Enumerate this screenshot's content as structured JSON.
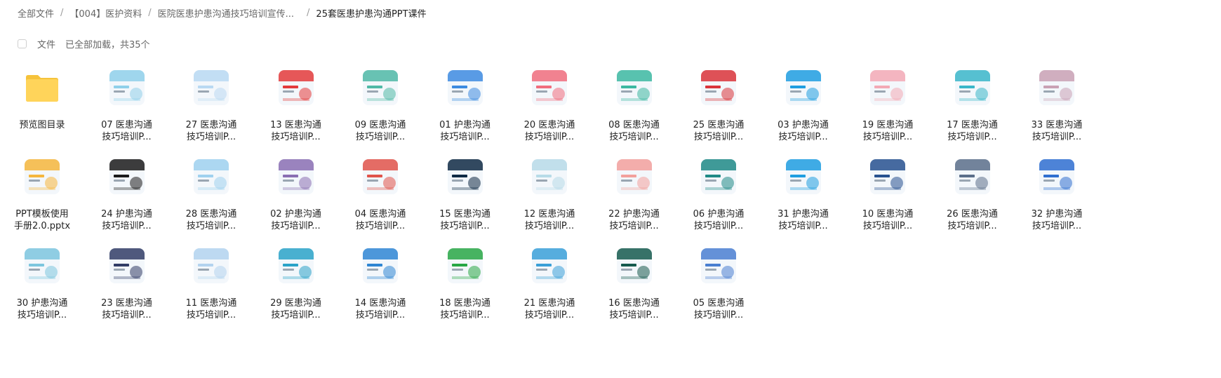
{
  "breadcrumb": {
    "items": [
      "全部文件",
      "【004】医护资料",
      "医院医患护患沟通技巧培训宣传...",
      "25套医患护患沟通PPT课件"
    ],
    "separator": "/"
  },
  "toolbar": {
    "label": "文件",
    "status": "已全部加载，共35个"
  },
  "files": [
    {
      "line1": "预览图目录",
      "line2": "",
      "icon": "folder-icon",
      "color": "#ffd45a"
    },
    {
      "line1": "07 医患沟通",
      "line2": "技巧培训P...",
      "icon": "ppt-thumb",
      "color": "#8fd0ea"
    },
    {
      "line1": "27 医患沟通",
      "line2": "技巧培训P...",
      "icon": "ppt-thumb",
      "color": "#b9d9f2"
    },
    {
      "line1": "13 医患沟通",
      "line2": "技巧培训P...",
      "icon": "ppt-thumb",
      "color": "#e33b3b"
    },
    {
      "line1": "09 医患沟通",
      "line2": "技巧培训P...",
      "icon": "ppt-thumb",
      "color": "#4fb9a6"
    },
    {
      "line1": "01 护患沟通",
      "line2": "技巧培训P...",
      "icon": "ppt-thumb",
      "color": "#3d8be0"
    },
    {
      "line1": "20 医患沟通",
      "line2": "技巧培训P...",
      "icon": "ppt-thumb",
      "color": "#f06d7d"
    },
    {
      "line1": "08 医患沟通",
      "line2": "技巧培训P...",
      "icon": "ppt-thumb",
      "color": "#3cb8a1"
    },
    {
      "line1": "25 医患沟通",
      "line2": "技巧培训P...",
      "icon": "ppt-thumb",
      "color": "#d9343a"
    },
    {
      "line1": "03 护患沟通",
      "line2": "技巧培训P...",
      "icon": "ppt-thumb",
      "color": "#1f9ee0"
    },
    {
      "line1": "19 医患沟通",
      "line2": "技巧培训P...",
      "icon": "ppt-thumb",
      "color": "#f3a9b5"
    },
    {
      "line1": "17 医患沟通",
      "line2": "技巧培训P...",
      "icon": "ppt-thumb",
      "color": "#39b6c9"
    },
    {
      "line1": "33 医患沟通",
      "line2": "技巧培训P...",
      "icon": "ppt-thumb",
      "color": "#c9a1b4"
    },
    {
      "line1": "PPT模板使用",
      "line2": "手册2.0.pptx",
      "icon": "ppt-thumb",
      "color": "#f5b63c"
    },
    {
      "line1": "24 护患沟通",
      "line2": "技巧培训P...",
      "icon": "ppt-thumb",
      "color": "#1b1b1b"
    },
    {
      "line1": "28 医患沟通",
      "line2": "技巧培训P...",
      "icon": "ppt-thumb",
      "color": "#9fd1ef"
    },
    {
      "line1": "02 护患沟通",
      "line2": "技巧培训P...",
      "icon": "ppt-thumb",
      "color": "#8a6fb3"
    },
    {
      "line1": "04 医患沟通",
      "line2": "技巧培训P...",
      "icon": "ppt-thumb",
      "color": "#e0534a"
    },
    {
      "line1": "15 医患沟通",
      "line2": "技巧培训P...",
      "icon": "ppt-thumb",
      "color": "#0f2a44"
    },
    {
      "line1": "12 医患沟通",
      "line2": "技巧培训P...",
      "icon": "ppt-thumb",
      "color": "#b7dbe8"
    },
    {
      "line1": "22 护患沟通",
      "line2": "技巧培训P...",
      "icon": "ppt-thumb",
      "color": "#f2a09c"
    },
    {
      "line1": "06 护患沟通",
      "line2": "技巧培训P...",
      "icon": "ppt-thumb",
      "color": "#1f8a86"
    },
    {
      "line1": "31 护患沟通",
      "line2": "技巧培训P...",
      "icon": "ppt-thumb",
      "color": "#1f9ee0"
    },
    {
      "line1": "10 医患沟通",
      "line2": "技巧培训P...",
      "icon": "ppt-thumb",
      "color": "#27518f"
    },
    {
      "line1": "26 医患沟通",
      "line2": "技巧培训P...",
      "icon": "ppt-thumb",
      "color": "#5b6f8a"
    },
    {
      "line1": "32 护患沟通",
      "line2": "技巧培训P...",
      "icon": "ppt-thumb",
      "color": "#2f6fd0"
    },
    {
      "line1": "30 护患沟通",
      "line2": "技巧培训P...",
      "icon": "ppt-thumb",
      "color": "#7cc6de"
    },
    {
      "line1": "23 医患沟通",
      "line2": "技巧培训P...",
      "icon": "ppt-thumb",
      "color": "#313d66"
    },
    {
      "line1": "11 医患沟通",
      "line2": "技巧培训P...",
      "icon": "ppt-thumb",
      "color": "#b3d3ef"
    },
    {
      "line1": "29 医患沟通",
      "line2": "技巧培训P...",
      "icon": "ppt-thumb",
      "color": "#2aa3c8"
    },
    {
      "line1": "14 医患沟通",
      "line2": "技巧培训P...",
      "icon": "ppt-thumb",
      "color": "#2f86d3"
    },
    {
      "line1": "18 医患沟通",
      "line2": "技巧培训P...",
      "icon": "ppt-thumb",
      "color": "#28a745"
    },
    {
      "line1": "21 医患沟通",
      "line2": "技巧培训P...",
      "icon": "ppt-thumb",
      "color": "#3aa0d8"
    },
    {
      "line1": "16 医患沟通",
      "line2": "技巧培训P...",
      "icon": "ppt-thumb",
      "color": "#155a4d"
    },
    {
      "line1": "05 医患沟通",
      "line2": "技巧培训P...",
      "icon": "ppt-thumb",
      "color": "#4a7fd1"
    }
  ]
}
